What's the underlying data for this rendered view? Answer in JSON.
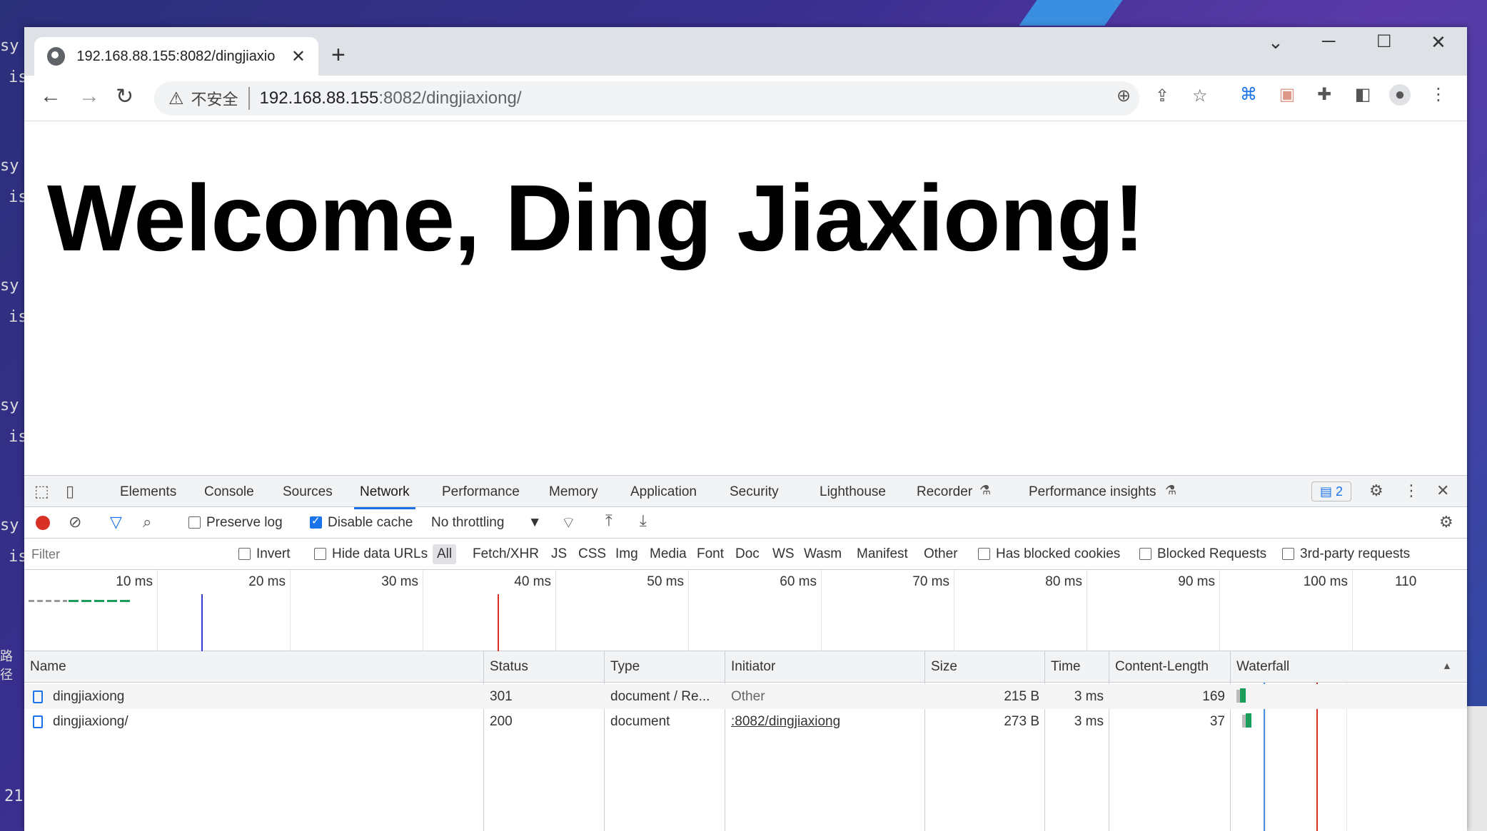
{
  "background_terminal": {
    "lines": [
      "sy",
      "is",
      "sy",
      "is",
      "sy",
      "is",
      "sy",
      "is",
      "sy",
      "is",
      "路径",
      "21"
    ]
  },
  "browser": {
    "tab_title": "192.168.88.155:8082/dingjiaxio",
    "tab_close": "✕",
    "new_tab": "+",
    "address": {
      "security_label": "不安全",
      "host": "192.168.88.155",
      "path": ":8082/dingjiaxiong/"
    }
  },
  "page": {
    "heading": "Welcome, Ding Jiaxiong!"
  },
  "devtools": {
    "tabs": [
      "Elements",
      "Console",
      "Sources",
      "Network",
      "Performance",
      "Memory",
      "Application",
      "Security",
      "Lighthouse",
      "Recorder",
      "Performance insights"
    ],
    "active_tab": "Network",
    "issues_count": "2",
    "toolbar": {
      "preserve_log": "Preserve log",
      "disable_cache": "Disable cache",
      "throttling": "No throttling"
    },
    "filter_bar": {
      "filter_placeholder": "Filter",
      "invert": "Invert",
      "hide_data_urls": "Hide data URLs",
      "types": [
        "All",
        "Fetch/XHR",
        "JS",
        "CSS",
        "Img",
        "Media",
        "Font",
        "Doc",
        "WS",
        "Wasm",
        "Manifest",
        "Other"
      ],
      "has_blocked_cookies": "Has blocked cookies",
      "blocked_requests": "Blocked Requests",
      "third_party": "3rd-party requests"
    },
    "overview_ticks": [
      "10 ms",
      "20 ms",
      "30 ms",
      "40 ms",
      "50 ms",
      "60 ms",
      "70 ms",
      "80 ms",
      "90 ms",
      "100 ms",
      "110"
    ],
    "columns": [
      "Name",
      "Status",
      "Type",
      "Initiator",
      "Size",
      "Time",
      "Content-Length",
      "Waterfall"
    ],
    "rows": [
      {
        "name": "dingjiaxiong",
        "status": "301",
        "type": "document / Re...",
        "initiator": "Other",
        "size": "215 B",
        "time": "3 ms",
        "content_length": "169"
      },
      {
        "name": "dingjiaxiong/",
        "status": "200",
        "type": "document",
        "initiator": ":8082/dingjiaxiong",
        "size": "273 B",
        "time": "3 ms",
        "content_length": "37"
      }
    ]
  }
}
